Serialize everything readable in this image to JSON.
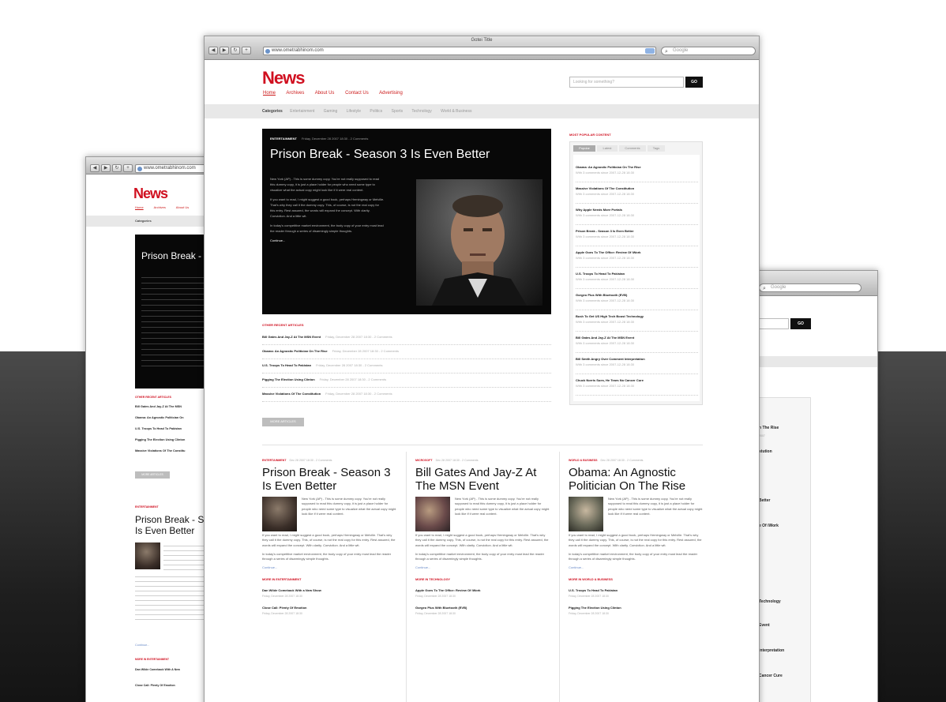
{
  "browser": {
    "title": "Gotei Title",
    "url": "www.ometrabhinom.com",
    "search_placeholder": "Google"
  },
  "site": {
    "logo": "News",
    "nav": [
      "Home",
      "Archives",
      "About Us",
      "Contact Us",
      "Advertising"
    ],
    "search_placeholder": "Looking for something?",
    "search_button": "GO",
    "categories_label": "Categories",
    "categories": [
      "Entertainment",
      "Gaming",
      "Lifestyle",
      "Politics",
      "Sports",
      "Technology",
      "World & Business"
    ]
  },
  "hero": {
    "category": "ENTERTAINMENT",
    "meta": "Friday, December 28 2007 18:30 - 2 Comments",
    "title": "Prison Break - Season 3 Is Even Better",
    "paragraphs": [
      "New York (AP) - This is some dummy copy. You're not really supposed to read this dummy copy, it is just a place holder for people who need some type to visualize what the actual copy might look like if it were real content.",
      "If you want to read, I might suggest a good book, perhaps Hemingway or Melville. That's why they call it the dummy copy. This, of course, is not the real copy for this entry. Rest assured, the words will expand the concept. With clarity. Conviction. And a little wit.",
      "In today's competitive market environment, the body copy of your entry must lead the reader through a series of disarmingly simple thoughts."
    ],
    "continue": "Continue..."
  },
  "recent": {
    "label": "OTHER RECENT ARTICLES",
    "items": [
      {
        "title": "Bill Gates And Jay-Z At The MSN Event",
        "meta": "Friday, December 28 2007 18:30 - 2 Comments"
      },
      {
        "title": "Obama: An Agnostic Politician On The Rise",
        "meta": "Friday, December 28 2007 18:30 - 2 Comments"
      },
      {
        "title": "U.S. Troops To Head To Pakistan",
        "meta": "Friday, December 28 2007 18:30 - 2 Comments"
      },
      {
        "title": "Pigging The Election Using Clinton",
        "meta": "Friday, December 28 2007 18:30 - 2 Comments"
      },
      {
        "title": "Massive Violations Of The Constitution",
        "meta": "Friday, December 28 2007 18:30 - 2 Comments"
      }
    ],
    "more_button": "MORE ARTICLES"
  },
  "sidebar": {
    "label": "MOST POPULAR CONTENT",
    "tabs": [
      "Popular",
      "Latest",
      "Comments",
      "Tags"
    ],
    "items": [
      {
        "title": "Obama: An Agnostic Politician On The Rise",
        "meta": "With 3 comments since 2007-12-28 18:30"
      },
      {
        "title": "Massive Violations Of The Constitution",
        "meta": "With 3 comments since 2007-12-28 18:30"
      },
      {
        "title": "Why Apple Needs More Portals",
        "meta": "With 3 comments since 2007-12-28 18:30"
      },
      {
        "title": "Prison Break - Season 3 Is Even Better",
        "meta": "With 3 comments since 2007-12-28 18:30"
      },
      {
        "title": "Apple Goes To The Office: Review Of iWork",
        "meta": "With 3 comments since 2007-12-28 18:30"
      },
      {
        "title": "U.S. Troops To Head To Pakistan",
        "meta": "With 3 comments since 2007-12-28 18:30"
      },
      {
        "title": "Gorgeo Plus With Bluetooth (EVB)",
        "meta": "With 3 comments since 2007-12-28 18:30"
      },
      {
        "title": "Bush To Get US High Tech Boost Technology",
        "meta": "With 3 comments since 2007-12-28 18:30"
      },
      {
        "title": "Bill Gates And Jay-Z At The MSN Event",
        "meta": "With 3 comments since 2007-12-28 18:30"
      },
      {
        "title": "Bill Smith Angry Over Comment Interpretation",
        "meta": "With 3 comments since 2007-12-28 18:30"
      },
      {
        "title": "Chuck Norris Sues, He Tears No Cancer Cure",
        "meta": "With 3 comments since 2007-12-28 18:30"
      }
    ]
  },
  "columns": [
    {
      "category": "ENTERTAINMENT",
      "meta": "Dec 28 2007 18:30 - 2 Comments",
      "title": "Prison Break - Season 3 Is Even Better",
      "p1": "New York (AP) - This is some dummy copy. You're not really supposed to read this dummy copy, it is just a place holder for people who need some type to visualize what the actual copy might look like if it were real content.",
      "p2": "If you want to read, I might suggest a good book, perhaps Hemingway or Melville. That's why they call it the dummy copy. This, of course, is not the real copy for this entry. Rest assured, the words will expand the concept. With clarity. Conviction. And a little wit.",
      "p3": "In today's competitive market environment, the body copy of your entry must lead the reader through a series of disarmingly simple thoughts.",
      "more": "Continue...",
      "sub_label": "MORE IN ENTERTAINMENT",
      "links": [
        {
          "title": "Dan Wilde Comeback With a New Show",
          "date": "Friday, December 28 2007 18:30"
        },
        {
          "title": "Close Call: Plenty Of Emotion",
          "date": "Friday, December 28 2007 18:30"
        }
      ]
    },
    {
      "category": "MICROSOFT",
      "meta": "Dec 28 2007 18:30 - 2 Comments",
      "title": "Bill Gates And Jay-Z At The MSN Event",
      "p1": "New York (AP) - This is some dummy copy. You're not really supposed to read this dummy copy, it is just a place holder for people who need some type to visualize what the actual copy might look like if it were real content.",
      "p2": "If you want to read, I might suggest a good book, perhaps Hemingway or Melville. That's why they call it the dummy copy. This, of course, is not the real copy for this entry. Rest assured, the words will expand the concept. With clarity. Conviction. And a little wit.",
      "p3": "In today's competitive market environment, the body copy of your entry must lead the reader through a series of disarmingly simple thoughts.",
      "more": "Continue...",
      "sub_label": "MORE IN TECHNOLOGY",
      "links": [
        {
          "title": "Apple Goes To The Office: Review Of iWork",
          "date": "Friday, December 28 2007 18:30"
        },
        {
          "title": "Gorgeo Plus With Bluetooth (EVB)",
          "date": "Friday, December 28 2007 18:30"
        }
      ]
    },
    {
      "category": "WORLD & BUSINESS",
      "meta": "Dec 28 2007 18:30 - 2 Comments",
      "title": "Obama: An Agnostic Politician On The Rise",
      "p1": "New York (AP) - This is some dummy copy. You're not really supposed to read this dummy copy, it is just a place holder for people who need some type to visualize what the actual copy might look like if it were real content.",
      "p2": "If you want to read, I might suggest a good book, perhaps Hemingway or Melville. That's why they call it the dummy copy. This, of course, is not the real copy for this entry. Rest assured, the words will expand the concept. With clarity. Conviction. And a little wit.",
      "p3": "In today's competitive market environment, the body copy of your entry must lead the reader through a series of disarmingly simple thoughts.",
      "more": "Continue...",
      "sub_label": "MORE IN WORLD & BUSINESS",
      "links": [
        {
          "title": "U.S. Troops To Head To Pakistan",
          "date": "Friday, December 28 2007 18:30"
        },
        {
          "title": "Pigging The Election Using Clinton",
          "date": "Friday, December 28 2007 18:30"
        }
      ]
    }
  ],
  "left_window": {
    "url": "www.ometrabhinom.com",
    "logo": "News",
    "nav": [
      "Home",
      "Archives",
      "About Us"
    ],
    "categories_label": "Categories",
    "hero_title": "Prison Break - S",
    "recent_label": "OTHER RECENT ARTICLES",
    "recent": [
      "Bill Gates And Jay-Z At The MSN",
      "Obama: An Agnostic Politician On",
      "U.S. Troops To Head To Pakistan",
      "Pigging The Election Using Clinton",
      "Massive Violations Of The Constitu"
    ],
    "more_button": "MORE ARTICLES",
    "col_category": "ENTERTAINMENT",
    "col_title": "Prison Break - S Is Even Better",
    "continue": "Continue...",
    "sub_label": "MORE IN ENTERTAINMENT",
    "links": [
      "Dan Wilde Comeback With A New",
      "Close Call: Plenty Of Emotion"
    ]
  },
  "right_window": {
    "search_placeholder": "Google",
    "search_button": "GO",
    "fragments": [
      "n The Rise",
      "stution",
      "Better",
      "e Of iWork",
      "Technology",
      "Event",
      "Interpretation",
      "Cancer Cure"
    ]
  }
}
